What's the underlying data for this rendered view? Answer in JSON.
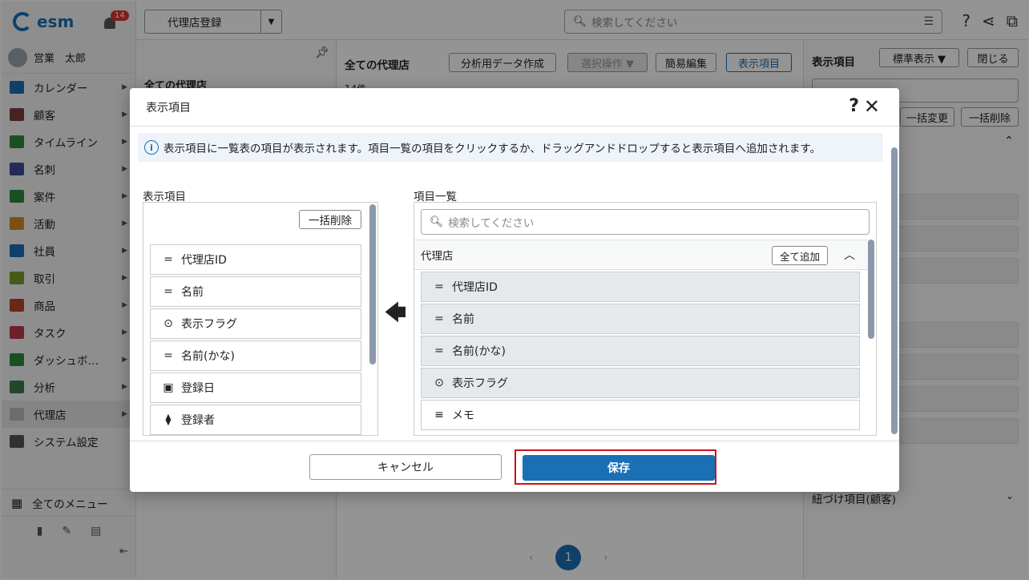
{
  "app": {
    "logo_text": "esm",
    "notification_count": "14",
    "user_name": "営業　太郎"
  },
  "sidebar": {
    "items": [
      {
        "label": "カレンダー",
        "color": "#1a6fb5",
        "icon": "calendar-icon"
      },
      {
        "label": "顧客",
        "color": "#7a3b3b",
        "icon": "building-icon"
      },
      {
        "label": "タイムライン",
        "color": "#2e8b3a",
        "icon": "chat-icon"
      },
      {
        "label": "名刺",
        "color": "#3f4b9a",
        "icon": "card-icon"
      },
      {
        "label": "案件",
        "color": "#2e8b3a",
        "icon": "folder-icon"
      },
      {
        "label": "活動",
        "color": "#d68a1d",
        "icon": "clipboard-icon"
      },
      {
        "label": "社員",
        "color": "#1a6fb5",
        "icon": "person-icon"
      },
      {
        "label": "取引",
        "color": "#7a9a2a",
        "icon": "book-icon"
      },
      {
        "label": "商品",
        "color": "#b5452a",
        "icon": "box-icon"
      },
      {
        "label": "タスク",
        "color": "#c0394b",
        "icon": "check-icon"
      },
      {
        "label": "ダッシュボ…",
        "color": "#2e8b3a",
        "icon": "dashboard-icon"
      },
      {
        "label": "分析",
        "color": "#3f7a4a",
        "icon": "chart-icon"
      },
      {
        "label": "代理店",
        "color": "#bbbbbb",
        "icon": "document-icon"
      },
      {
        "label": "システム設定",
        "color": "#555555",
        "icon": "gear-icon"
      }
    ],
    "all_menu": "全てのメニュー"
  },
  "topbar": {
    "register_label": "代理店登録",
    "search_placeholder": "検索してください"
  },
  "col2": {
    "title": "全ての代理店"
  },
  "main": {
    "title": "全ての代理店",
    "btn_export": "分析用データ作成",
    "btn_select": "選択操作 ▼",
    "btn_simple_edit": "簡易編集",
    "btn_display": "表示項目",
    "count": "14件",
    "page": "1"
  },
  "right": {
    "title": "表示項目",
    "btn_standard": "標準表示 ▼",
    "btn_close": "閉じる",
    "btn_bulk_change": "一括変更",
    "btn_bulk_delete": "一括削除",
    "footer": "紐づけ項目(顧客)"
  },
  "modal": {
    "title": "表示項目",
    "info": "表示項目に一覧表の項目が表示されます。項目一覧の項目をクリックするか、ドラッグアンドドロップすると表示項目へ追加されます。",
    "left_label": "表示項目",
    "bulk_delete": "一括削除",
    "left_items": [
      {
        "label": "代理店ID",
        "icon": "text-field-icon"
      },
      {
        "label": "名前",
        "icon": "text-field-icon"
      },
      {
        "label": "表示フラグ",
        "icon": "dropdown-circle-icon"
      },
      {
        "label": "名前(かな)",
        "icon": "text-field-icon"
      },
      {
        "label": "登録日",
        "icon": "calendar-icon"
      },
      {
        "label": "登録者",
        "icon": "tag-icon"
      }
    ],
    "right_label": "項目一覧",
    "search_placeholder": "検索してください",
    "group_name": "代理店",
    "add_all": "全て追加",
    "right_items": [
      {
        "label": "代理店ID",
        "icon": "text-field-icon",
        "selected": true
      },
      {
        "label": "名前",
        "icon": "text-field-icon",
        "selected": true
      },
      {
        "label": "名前(かな)",
        "icon": "text-field-icon",
        "selected": true
      },
      {
        "label": "表示フラグ",
        "icon": "dropdown-circle-icon",
        "selected": true
      },
      {
        "label": "メモ",
        "icon": "multiline-text-icon",
        "selected": false
      }
    ],
    "cancel": "キャンセル",
    "save": "保存",
    "save_highlight_color": "#d0101d",
    "accent_color": "#1a6fb5"
  }
}
